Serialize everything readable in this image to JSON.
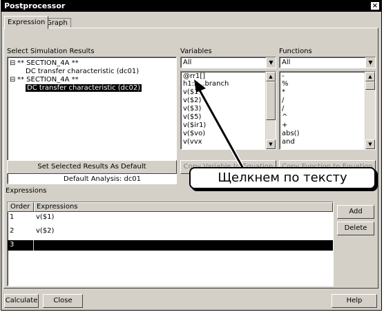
{
  "window": {
    "title": "Postprocessor",
    "close_glyph": "×"
  },
  "tabs": [
    {
      "label": "Expression"
    },
    {
      "label": "Graph"
    }
  ],
  "simulation": {
    "label": "Select Simulation Results",
    "tree": [
      {
        "text": "** SECTION_4A **"
      },
      {
        "text": "DC transfer characteristic (dc01)"
      },
      {
        "text": "** SECTION_4A **"
      },
      {
        "text": "DC transfer characteristic (dc02)"
      }
    ],
    "set_default_label": "Set Selected Results As Default",
    "default_analysis": "Default Analysis: dc01"
  },
  "variables": {
    "label": "Variables",
    "filter_value": "All",
    "items": [
      "@rr1[]",
      "h1:x...branch",
      "v($1)",
      "v($2)",
      "v($3)",
      "v($5)",
      "v($ir1)",
      "v($vo)",
      "v(vvx"
    ],
    "copy_label": "Copy Variable to Equation"
  },
  "functions": {
    "label": "Functions",
    "filter_value": "All",
    "items": [
      "-",
      "%",
      "*",
      "/",
      "/",
      "^",
      "+",
      "abs()",
      "and"
    ],
    "copy_label": "Copy Function to Equation"
  },
  "callout": {
    "text": "Щелкнем по тексту"
  },
  "expressions": {
    "label": "Expressions",
    "columns": [
      "Order",
      "Expressions"
    ],
    "rows": [
      {
        "order": "1",
        "expr": "v($1)"
      },
      {
        "order": "2",
        "expr": "v($2)"
      },
      {
        "order": "3",
        "expr": ""
      }
    ],
    "add_label": "Add",
    "delete_label": "Delete"
  },
  "footer": {
    "calculate_label": "Calculate",
    "close_label": "Close",
    "help_label": "Help"
  }
}
